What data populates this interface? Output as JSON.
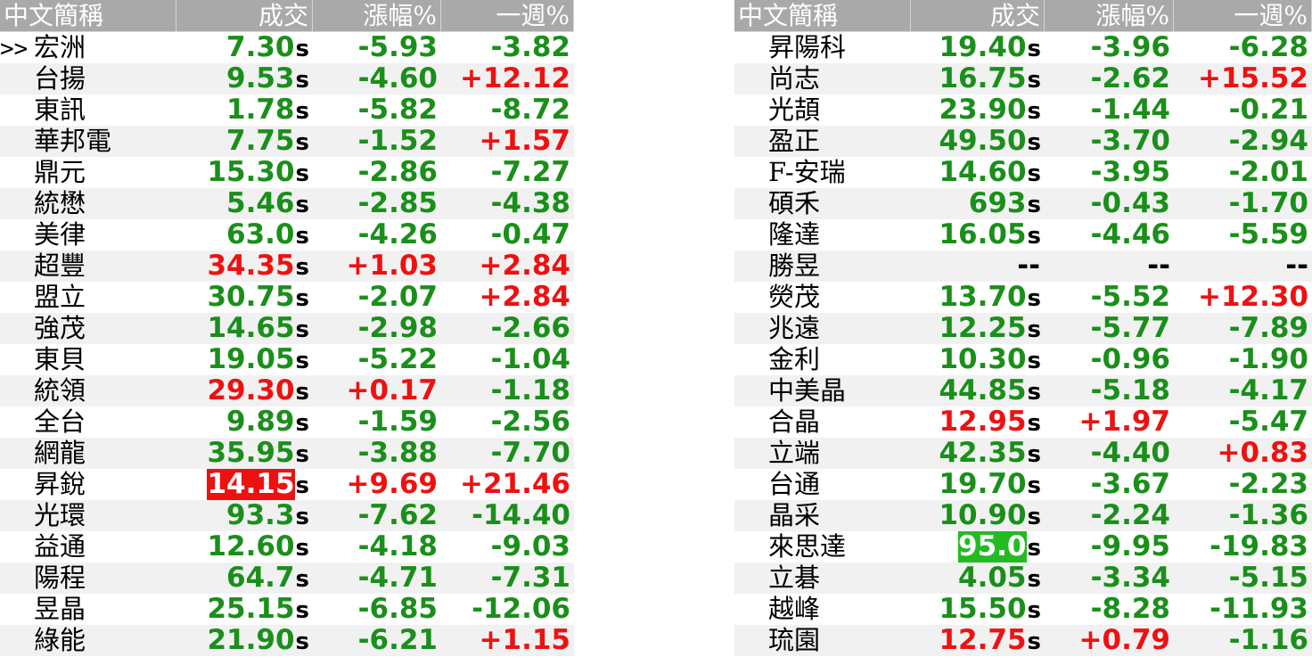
{
  "headers": {
    "name": "中文簡稱",
    "price": "成交",
    "change": "漲幅%",
    "week": "一週%"
  },
  "colors": {
    "up": "#ee1111",
    "down": "#1a8f1a",
    "header_bg": "#a9a9a9",
    "limit_up_bg": "#ee1111",
    "limit_down_bg": "#22bb22"
  },
  "current_marker": ">>",
  "left": [
    {
      "name": "宏洲",
      "price": "7.30",
      "sfx": "s",
      "chg": "-5.93",
      "week": "-3.82",
      "pc": "green",
      "cc": "green",
      "wc": "green",
      "current": true
    },
    {
      "name": "台揚",
      "price": "9.53",
      "sfx": "s",
      "chg": "-4.60",
      "week": "+12.12",
      "pc": "green",
      "cc": "green",
      "wc": "red"
    },
    {
      "name": "東訊",
      "price": "1.78",
      "sfx": "s",
      "chg": "-5.82",
      "week": "-8.72",
      "pc": "green",
      "cc": "green",
      "wc": "green"
    },
    {
      "name": "華邦電",
      "price": "7.75",
      "sfx": "s",
      "chg": "-1.52",
      "week": "+1.57",
      "pc": "green",
      "cc": "green",
      "wc": "red"
    },
    {
      "name": "鼎元",
      "price": "15.30",
      "sfx": "s",
      "chg": "-2.86",
      "week": "-7.27",
      "pc": "green",
      "cc": "green",
      "wc": "green"
    },
    {
      "name": "統懋",
      "price": "5.46",
      "sfx": "s",
      "chg": "-2.85",
      "week": "-4.38",
      "pc": "green",
      "cc": "green",
      "wc": "green"
    },
    {
      "name": "美律",
      "price": "63.0",
      "sfx": "s",
      "chg": "-4.26",
      "week": "-0.47",
      "pc": "green",
      "cc": "green",
      "wc": "green"
    },
    {
      "name": "超豐",
      "price": "34.35",
      "sfx": "s",
      "chg": "+1.03",
      "week": "+2.84",
      "pc": "red",
      "cc": "red",
      "wc": "red"
    },
    {
      "name": "盟立",
      "price": "30.75",
      "sfx": "s",
      "chg": "-2.07",
      "week": "+2.84",
      "pc": "green",
      "cc": "green",
      "wc": "red"
    },
    {
      "name": "強茂",
      "price": "14.65",
      "sfx": "s",
      "chg": "-2.98",
      "week": "-2.66",
      "pc": "green",
      "cc": "green",
      "wc": "green"
    },
    {
      "name": "東貝",
      "price": "19.05",
      "sfx": "s",
      "chg": "-5.22",
      "week": "-1.04",
      "pc": "green",
      "cc": "green",
      "wc": "green"
    },
    {
      "name": "統領",
      "price": "29.30",
      "sfx": "s",
      "chg": "+0.17",
      "week": "-1.18",
      "pc": "red",
      "cc": "red",
      "wc": "green"
    },
    {
      "name": "全台",
      "price": "9.89",
      "sfx": "s",
      "chg": "-1.59",
      "week": "-2.56",
      "pc": "green",
      "cc": "green",
      "wc": "green"
    },
    {
      "name": "網龍",
      "price": "35.95",
      "sfx": "s",
      "chg": "-3.88",
      "week": "-7.70",
      "pc": "green",
      "cc": "green",
      "wc": "green"
    },
    {
      "name": "昇銳",
      "price": "14.15",
      "sfx": "s",
      "chg": "+9.69",
      "week": "+21.46",
      "pc": "bg-red",
      "cc": "red",
      "wc": "red"
    },
    {
      "name": "光環",
      "price": "93.3",
      "sfx": "s",
      "chg": "-7.62",
      "week": "-14.40",
      "pc": "green",
      "cc": "green",
      "wc": "green"
    },
    {
      "name": "益通",
      "price": "12.60",
      "sfx": "s",
      "chg": "-4.18",
      "week": "-9.03",
      "pc": "green",
      "cc": "green",
      "wc": "green"
    },
    {
      "name": "陽程",
      "price": "64.7",
      "sfx": "s",
      "chg": "-4.71",
      "week": "-7.31",
      "pc": "green",
      "cc": "green",
      "wc": "green"
    },
    {
      "name": "昱晶",
      "price": "25.15",
      "sfx": "s",
      "chg": "-6.85",
      "week": "-12.06",
      "pc": "green",
      "cc": "green",
      "wc": "green"
    },
    {
      "name": "綠能",
      "price": "21.90",
      "sfx": "s",
      "chg": "-6.21",
      "week": "+1.15",
      "pc": "green",
      "cc": "green",
      "wc": "red"
    }
  ],
  "right": [
    {
      "name": "昇陽科",
      "price": "19.40",
      "sfx": "s",
      "chg": "-3.96",
      "week": "-6.28",
      "pc": "green",
      "cc": "green",
      "wc": "green"
    },
    {
      "name": "尚志",
      "price": "16.75",
      "sfx": "s",
      "chg": "-2.62",
      "week": "+15.52",
      "pc": "green",
      "cc": "green",
      "wc": "red"
    },
    {
      "name": "光頡",
      "price": "23.90",
      "sfx": "s",
      "chg": "-1.44",
      "week": "-0.21",
      "pc": "green",
      "cc": "green",
      "wc": "green"
    },
    {
      "name": "盈正",
      "price": "49.50",
      "sfx": "s",
      "chg": "-3.70",
      "week": "-2.94",
      "pc": "green",
      "cc": "green",
      "wc": "green"
    },
    {
      "name": "F-安瑞",
      "price": "14.60",
      "sfx": "s",
      "chg": "-3.95",
      "week": "-2.01",
      "pc": "green",
      "cc": "green",
      "wc": "green"
    },
    {
      "name": "碩禾",
      "price": "693",
      "sfx": "s",
      "chg": "-0.43",
      "week": "-1.70",
      "pc": "green",
      "cc": "green",
      "wc": "green"
    },
    {
      "name": "隆達",
      "price": "16.05",
      "sfx": "s",
      "chg": "-4.46",
      "week": "-5.59",
      "pc": "green",
      "cc": "green",
      "wc": "green"
    },
    {
      "name": "勝昱",
      "price": "--",
      "sfx": "",
      "chg": "--",
      "week": "--",
      "pc": "dash",
      "cc": "dash",
      "wc": "dash"
    },
    {
      "name": "熒茂",
      "price": "13.70",
      "sfx": "s",
      "chg": "-5.52",
      "week": "+12.30",
      "pc": "green",
      "cc": "green",
      "wc": "red"
    },
    {
      "name": "兆遠",
      "price": "12.25",
      "sfx": "s",
      "chg": "-5.77",
      "week": "-7.89",
      "pc": "green",
      "cc": "green",
      "wc": "green"
    },
    {
      "name": "金利",
      "price": "10.30",
      "sfx": "s",
      "chg": "-0.96",
      "week": "-1.90",
      "pc": "green",
      "cc": "green",
      "wc": "green"
    },
    {
      "name": "中美晶",
      "price": "44.85",
      "sfx": "s",
      "chg": "-5.18",
      "week": "-4.17",
      "pc": "green",
      "cc": "green",
      "wc": "green"
    },
    {
      "name": "合晶",
      "price": "12.95",
      "sfx": "s",
      "chg": "+1.97",
      "week": "-5.47",
      "pc": "red",
      "cc": "red",
      "wc": "green"
    },
    {
      "name": "立端",
      "price": "42.35",
      "sfx": "s",
      "chg": "-4.40",
      "week": "+0.83",
      "pc": "green",
      "cc": "green",
      "wc": "red"
    },
    {
      "name": "台通",
      "price": "19.70",
      "sfx": "s",
      "chg": "-3.67",
      "week": "-2.23",
      "pc": "green",
      "cc": "green",
      "wc": "green"
    },
    {
      "name": "晶采",
      "price": "10.90",
      "sfx": "s",
      "chg": "-2.24",
      "week": "-1.36",
      "pc": "green",
      "cc": "green",
      "wc": "green"
    },
    {
      "name": "來思達",
      "price": "95.0",
      "sfx": "s",
      "chg": "-9.95",
      "week": "-19.83",
      "pc": "bg-green",
      "cc": "green",
      "wc": "green"
    },
    {
      "name": "立碁",
      "price": "4.05",
      "sfx": "s",
      "chg": "-3.34",
      "week": "-5.15",
      "pc": "green",
      "cc": "green",
      "wc": "green"
    },
    {
      "name": "越峰",
      "price": "15.50",
      "sfx": "s",
      "chg": "-8.28",
      "week": "-11.93",
      "pc": "green",
      "cc": "green",
      "wc": "green"
    },
    {
      "name": "琉園",
      "price": "12.75",
      "sfx": "s",
      "chg": "+0.79",
      "week": "-1.16",
      "pc": "red",
      "cc": "red",
      "wc": "green"
    }
  ]
}
